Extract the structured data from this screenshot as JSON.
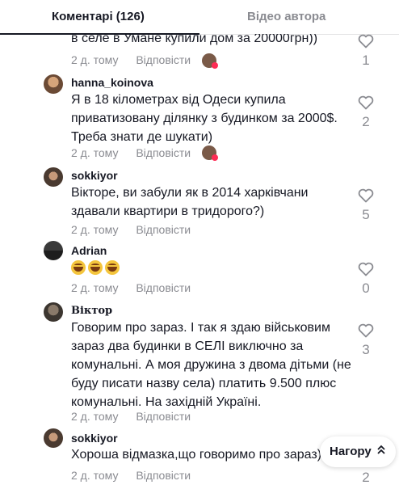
{
  "tabs": {
    "comments": "Коментарі (126)",
    "author_videos": "Відео автора"
  },
  "scroll_top_label": "Нагору",
  "comments": [
    {
      "username": "",
      "text": "в селе в Умане купили дом за 20000грн))",
      "time": "2 д. тому",
      "reply": "Відповісти",
      "likes": "1",
      "author_liked": true
    },
    {
      "username": "hanna_koinova",
      "text": "Я в 18 кілометрах від Одеси купила приватизовану ділянку з будинком за 2000$. Треба знати де шукати)",
      "time": "2 д. тому",
      "reply": "Відповісти",
      "likes": "2",
      "author_liked": true
    },
    {
      "username": "sokkiyor",
      "text": "Вікторе, ви забули як в 2014 харківчани здавали квартири в тридорого?)",
      "time": "2 д. тому",
      "reply": "Відповісти",
      "likes": "5",
      "author_liked": false
    },
    {
      "username": "Adrian",
      "text": "",
      "emoji_count": 3,
      "time": "2 д. тому",
      "reply": "Відповісти",
      "likes": "0",
      "author_liked": false
    },
    {
      "username": "Віктор",
      "text": "Говорим про зараз. І так я здаю військовим зараз два будинки в СЕЛІ виключно за комунальні. А моя дружина з двома дітьми (не буду писати назву села) платить 9.500 плюс комунальні. На західній Україні.",
      "time": "2 д. тому",
      "reply": "Відповісти",
      "likes": "3",
      "author_liked": false
    },
    {
      "username": "sokkiyor",
      "text": "Хороша відмазка,що говоримо про зараз)",
      "time": "2 д. тому",
      "reply": "Відповісти",
      "likes": "2",
      "author_liked": false
    }
  ],
  "colors": {
    "text": "#161823",
    "muted": "#8a8b91",
    "heart": "#8a8b91"
  }
}
